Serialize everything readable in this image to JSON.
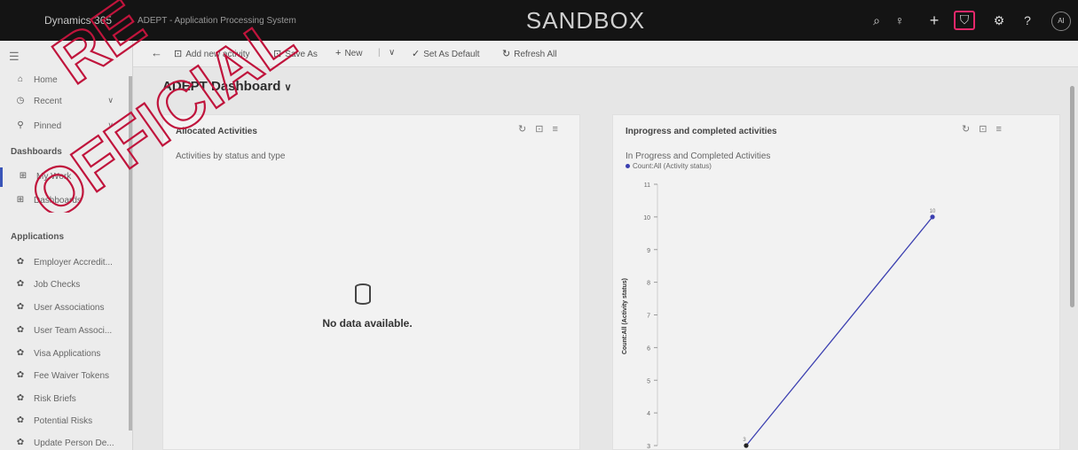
{
  "header": {
    "brand": "Dynamics 365",
    "app_name": "ADEPT - Application Processing System",
    "environment": "SANDBOX",
    "buttons": [
      {
        "name": "search",
        "glyph": "⌕"
      },
      {
        "name": "lightbulb",
        "glyph": "♀"
      },
      {
        "name": "add",
        "glyph": "+"
      },
      {
        "name": "filter",
        "glyph": "⛉"
      },
      {
        "name": "settings",
        "glyph": "⚙"
      },
      {
        "name": "help",
        "glyph": "?"
      }
    ],
    "avatar_initials": "AI"
  },
  "watermark": {
    "text": "OFFICIAL",
    "partial_text": "RE"
  },
  "toolbar": {
    "back_glyph": "←",
    "add_activity": "Add new activity",
    "save_as": "Save As",
    "new": "New",
    "set_default": "Set As Default",
    "refresh_all": "Refresh All"
  },
  "sidebar": {
    "top_items": [
      {
        "label": "Home",
        "icon": "⌂"
      },
      {
        "label": "Recent",
        "icon": "◷",
        "chevron": "∨"
      },
      {
        "label": "Pinned",
        "icon": "⚲",
        "chevron": "∨"
      }
    ],
    "section_dashboards": "Dashboards",
    "dashboards": [
      {
        "label": "My Work",
        "icon": "⊞",
        "selected": true
      },
      {
        "label": "Dashboards",
        "icon": "⊞"
      }
    ],
    "section_applications": "Applications",
    "applications": [
      {
        "label": "Employer Accredit...",
        "icon": "✿"
      },
      {
        "label": "Job Checks",
        "icon": "✿"
      },
      {
        "label": "User Associations",
        "icon": "✿"
      },
      {
        "label": "User Team Associ...",
        "icon": "✿"
      },
      {
        "label": "Visa Applications",
        "icon": "✿"
      },
      {
        "label": "Fee Waiver Tokens",
        "icon": "✿"
      },
      {
        "label": "Risk Briefs",
        "icon": "✿"
      },
      {
        "label": "Potential Risks",
        "icon": "✿"
      },
      {
        "label": "Update Person De...",
        "icon": "✿"
      }
    ]
  },
  "dashboard": {
    "title": "ADEPT Dashboard",
    "cards": [
      {
        "title": "Allocated Activities",
        "subtitle": "Activities by status and type",
        "empty_text": "No data available."
      },
      {
        "title": "Inprogress and completed activities",
        "subtitle": "In Progress and Completed Activities",
        "legend": "Count:All (Activity status)"
      }
    ]
  },
  "chart_data": {
    "type": "line",
    "title": "In Progress and Completed Activities",
    "ylabel": "Count:All (Activity status)",
    "series": [
      {
        "name": "Count:All (Activity status)",
        "values": [
          [
            0,
            3
          ],
          [
            1,
            10
          ]
        ],
        "labels": [
          "3",
          "10"
        ]
      }
    ],
    "y_ticks": [
      3,
      4,
      5,
      6,
      7,
      8,
      9,
      10,
      11
    ],
    "ylim": [
      3,
      11
    ],
    "color": "#3b3fb0"
  }
}
